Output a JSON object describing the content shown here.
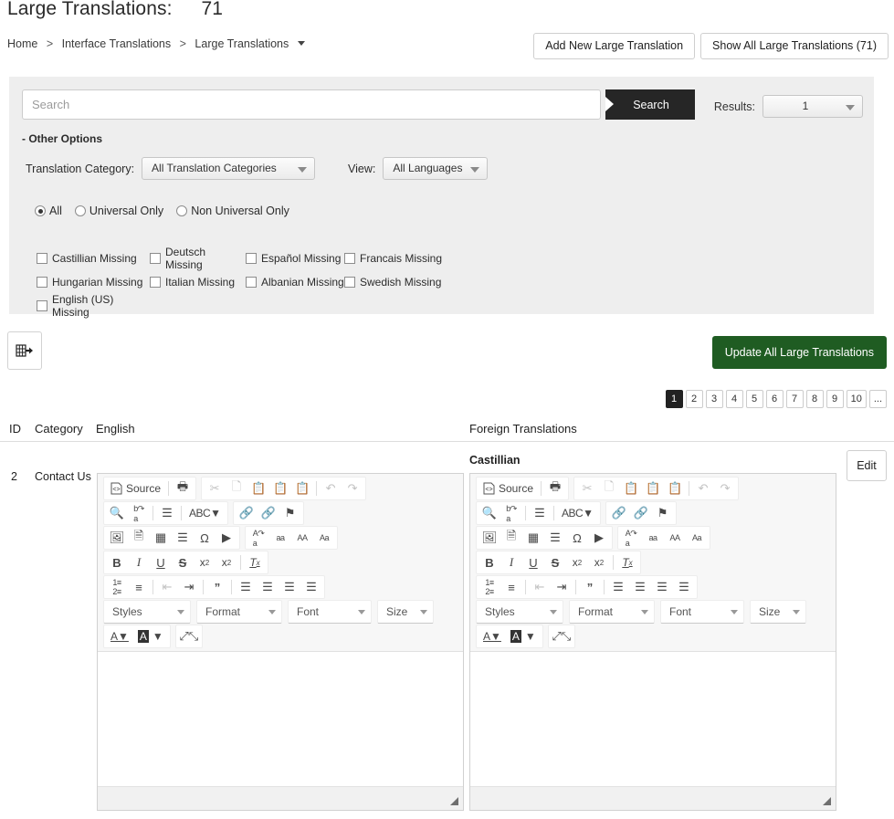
{
  "header": {
    "title": "Large Translations:",
    "count": "71",
    "breadcrumb": [
      {
        "label": "Home"
      },
      {
        "label": "Interface Translations"
      },
      {
        "label": "Large Translations"
      }
    ],
    "breadcrumb_separator": ">",
    "add_button": "Add New Large Translation",
    "show_all_button": "Show All Large Translations (71)"
  },
  "search": {
    "placeholder": "Search",
    "value": "",
    "button_label": "Search",
    "results_label": "Results:",
    "results_value": "1"
  },
  "filters": {
    "other_options_label": "- Other Options",
    "translation_category_label": "Translation Category:",
    "translation_category_value": "All Translation Categories",
    "view_label": "View:",
    "view_value": "All Languages",
    "radios": [
      {
        "label": "All",
        "checked": true
      },
      {
        "label": "Universal Only",
        "checked": false
      },
      {
        "label": "Non Universal Only",
        "checked": false
      }
    ],
    "checkboxes": [
      {
        "label": "Castillian Missing",
        "checked": false
      },
      {
        "label": "Deutsch Missing",
        "checked": false
      },
      {
        "label": "Español Missing",
        "checked": false
      },
      {
        "label": "Francais Missing",
        "checked": false
      },
      {
        "label": "Hungarian Missing",
        "checked": false
      },
      {
        "label": "Italian Missing",
        "checked": false
      },
      {
        "label": "Albanian Missing",
        "checked": false
      },
      {
        "label": "Swedish Missing",
        "checked": false
      },
      {
        "label": "English (US) Missing",
        "checked": false
      }
    ]
  },
  "actions": {
    "export_icon": "export-grid-icon",
    "update_all_label": "Update All Large Translations"
  },
  "pagination": {
    "pages": [
      "1",
      "2",
      "3",
      "4",
      "5",
      "6",
      "7",
      "8",
      "9",
      "10",
      "..."
    ],
    "active": "1"
  },
  "table": {
    "headers": {
      "id": "ID",
      "category": "Category",
      "english": "English",
      "foreign": "Foreign Translations"
    },
    "row": {
      "id": "2",
      "category": "Contact Us",
      "language": "Castillian",
      "edit_label": "Edit",
      "english_content": "",
      "foreign_content": ""
    }
  },
  "editor": {
    "source_label": "Source",
    "combos": {
      "styles": "Styles",
      "format": "Format",
      "font": "Font",
      "size": "Size"
    },
    "case_buttons": [
      "aa",
      "AA",
      "Aa"
    ]
  },
  "colors": {
    "accent_green": "#1f5c22",
    "search_black": "#262626",
    "panel_gray": "#eeeeee",
    "toolbar_gray": "#f7f7f7"
  }
}
